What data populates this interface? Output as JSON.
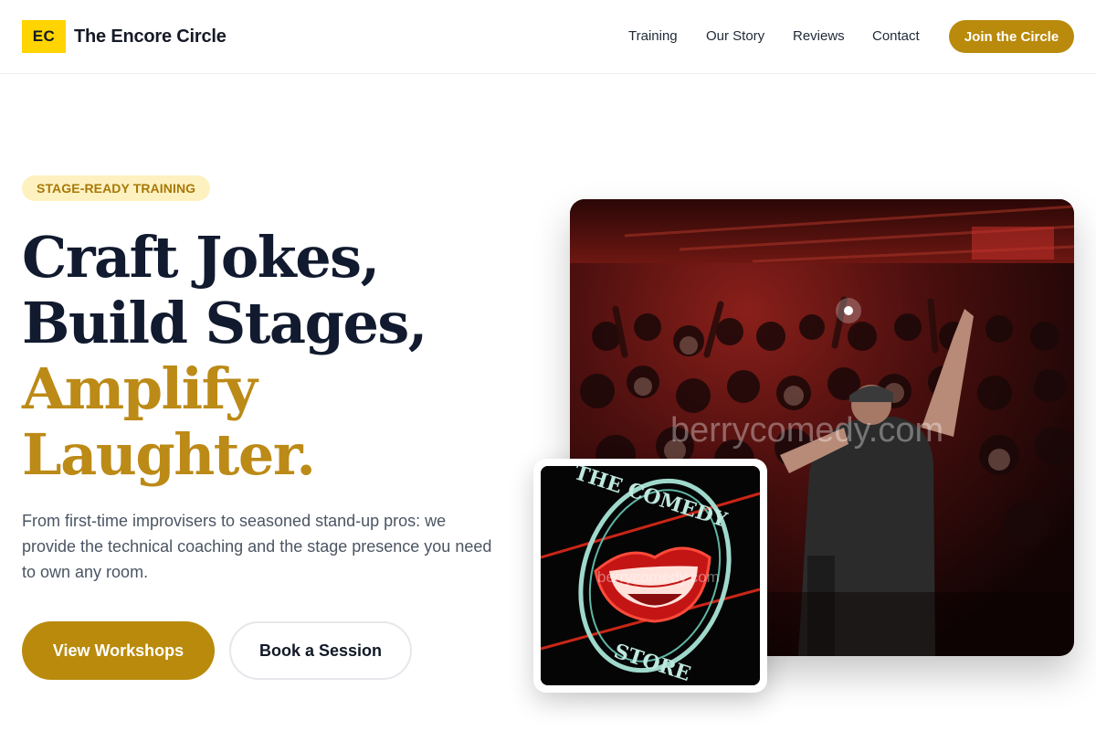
{
  "header": {
    "logo_initials": "EC",
    "brand_name": "The Encore Circle",
    "nav": [
      "Training",
      "Our Story",
      "Reviews",
      "Contact"
    ],
    "cta_label": "Join the Circle"
  },
  "hero": {
    "tag": "STAGE-READY TRAINING",
    "headline_dark_1": "Craft Jokes,",
    "headline_dark_2": "Build Stages,",
    "headline_gold_1": "Amplify",
    "headline_gold_2": "Laughter.",
    "description": "From first-time improvisers to seasoned stand-up pros: we provide the technical coaching and the stage presence you need to own any room.",
    "primary_button": "View Workshops",
    "secondary_button": "Book a Session"
  },
  "images": {
    "crowd_watermark": "berrycomedy.com",
    "neon_top_text": "THE COMEDY",
    "neon_bottom_text": "STORE",
    "neon_watermark": "berrycomedy.com"
  },
  "colors": {
    "accent_gold": "#b98a0c",
    "logo_yellow": "#ffd400",
    "headline_dark": "#111a2e"
  }
}
